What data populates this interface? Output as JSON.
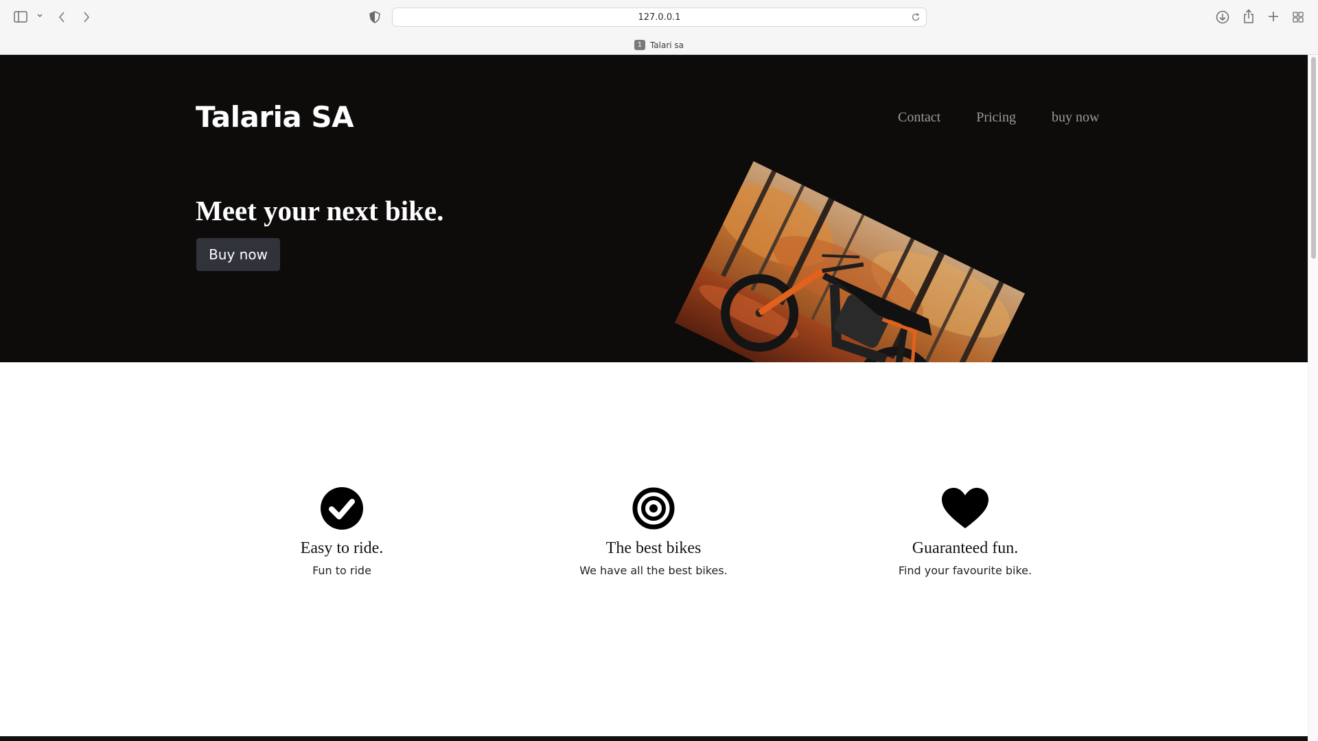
{
  "browser": {
    "url": "127.0.0.1",
    "tab_index": "1",
    "tab_title": "Talari sa",
    "icons": [
      "sidebar-icon",
      "chevron-down-icon",
      "back-icon",
      "forward-icon",
      "shield-icon",
      "reload-icon",
      "download-icon",
      "share-icon",
      "new-tab-icon",
      "tab-overview-icon"
    ]
  },
  "header": {
    "brand": "Talaria SA",
    "nav": [
      "Contact",
      "Pricing",
      "buy now"
    ]
  },
  "hero": {
    "headline": "Meet your next bike.",
    "button_label": "Buy now",
    "image": "dirt-bike-in-autumn-forest"
  },
  "features": [
    {
      "icon": "check-circle-icon",
      "title": "Easy to ride.",
      "description": "Fun to ride"
    },
    {
      "icon": "target-icon",
      "title": "The best bikes",
      "description": "We have all the best bikes."
    },
    {
      "icon": "heart-icon",
      "title": "Guaranteed fun.",
      "description": "Find your favourite bike."
    }
  ],
  "colors": {
    "hero_background": "#0e0b0b",
    "button_background": "#30333a",
    "nav_link": "#9b9b9b"
  }
}
